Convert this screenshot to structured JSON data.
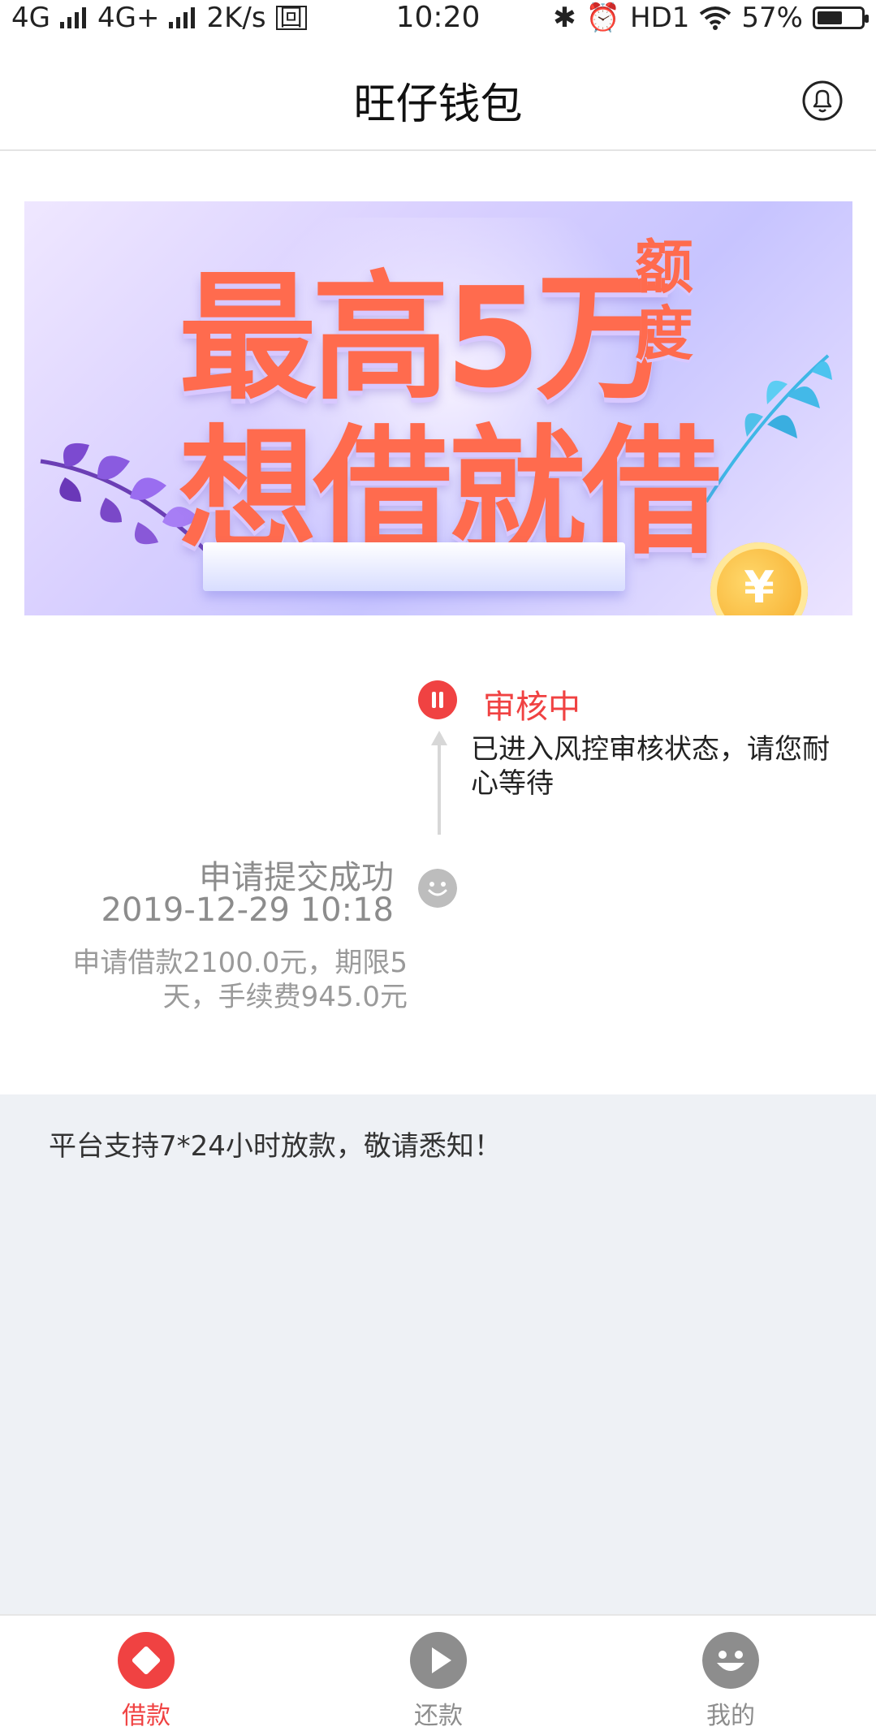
{
  "status_bar": {
    "network1": "4G",
    "network2": "4G+",
    "speed": "2K/s",
    "time": "10:20",
    "hd": "HD1",
    "battery": "57%",
    "battery_level": 0.57
  },
  "header": {
    "title": "旺仔钱包"
  },
  "banner": {
    "line1": "最高5万",
    "line1_suffix": "额度",
    "line2": "想借就借",
    "coin_symbol": "¥"
  },
  "timeline": {
    "current": {
      "title": "审核中",
      "desc": "已进入风控审核状态，请您耐心等待"
    },
    "submitted": {
      "title": "申请提交成功",
      "time": "2019-12-29 10:18",
      "desc": "申请借款2100.0元，期限5天，手续费945.0元"
    }
  },
  "notice": {
    "text": "平台支持7*24小时放款，敬请悉知！"
  },
  "bottom_nav": {
    "items": [
      {
        "label": "借款",
        "icon": "diamond-icon",
        "active": true
      },
      {
        "label": "还款",
        "icon": "play-icon",
        "active": false
      },
      {
        "label": "我的",
        "icon": "smiley-icon",
        "active": false
      }
    ]
  },
  "colors": {
    "accent": "#f04242",
    "inactive": "#8d8d8d",
    "notice_bg": "#eef1f5",
    "banner_text": "#ff6b4e"
  }
}
